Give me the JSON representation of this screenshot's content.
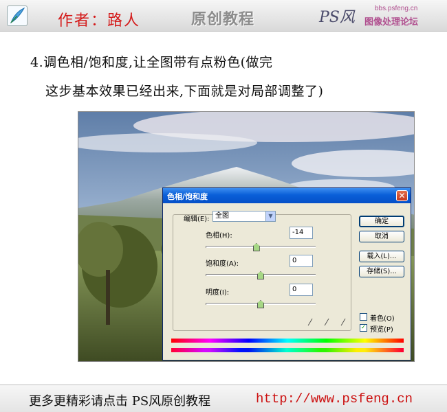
{
  "header": {
    "author": "作者：路人",
    "title": "原创教程",
    "brand_mark": "PS风",
    "url": "bbs.psfeng.cn",
    "forum": "图像处理论坛"
  },
  "step": {
    "line1": "4.调色相/饱和度,让全图带有点粉色(做完",
    "line2": "这步基本效果已经出来,下面就是对局部调整了)"
  },
  "dialog": {
    "title": "色相/饱和度",
    "close": "✕",
    "edit_label": "编辑(E):",
    "edit_value": "全图",
    "hue_label": "色相(H):",
    "hue_value": "-14",
    "hue_level": -14,
    "saturation_label": "饱和度(A):",
    "saturation_value": "0",
    "saturation_level": 0,
    "lightness_label": "明度(I):",
    "lightness_value": "0",
    "lightness_level": 0,
    "buttons": {
      "ok": "确定",
      "cancel": "取消",
      "load": "载入(L)...",
      "save": "存储(S)..."
    },
    "colorize_label": "着色(O)",
    "colorize_checked": false,
    "preview_label": "预览(P)",
    "preview_checked": true,
    "preview_mark": "✓"
  },
  "footer": {
    "text": "更多更精彩请点击 PS风原创教程",
    "link": "http://www.psfeng.cn"
  }
}
